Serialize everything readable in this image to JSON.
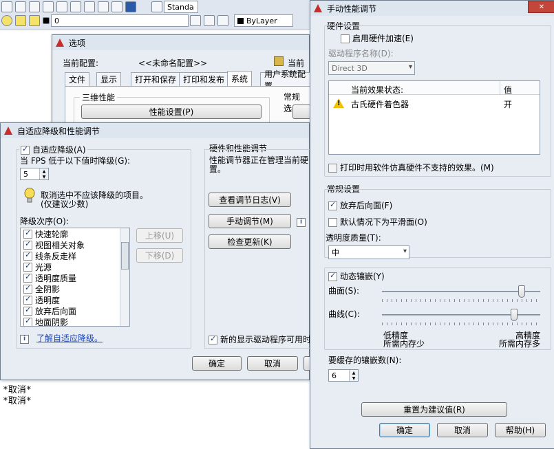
{
  "toolbar": {
    "layer_value": "0",
    "linetype_value": "ByLayer",
    "style_value": "Standa"
  },
  "command_line": [
    "*取消*",
    "*取消*"
  ],
  "options_dialog": {
    "title": "选项",
    "current_profile_label": "当前配置:",
    "current_profile_value": "<<未命名配置>>",
    "current_drawing_label": "当前图",
    "tabs": [
      "文件",
      "显示",
      "打开和保存",
      "打印和发布",
      "系统",
      "用户系统配置"
    ],
    "active_tab": "系统",
    "group_3d": "三维性能",
    "perf_settings_btn": "性能设置(P)",
    "group_general": "常规选"
  },
  "adaptive_dialog": {
    "title": "自适应降级和性能调节",
    "adaptive_degrade_label": "自适应降级(A)",
    "fps_label": "当 FPS 低于以下值时降级(G):",
    "fps_value": "5",
    "tip_line1": "取消选中不应该降级的项目。",
    "tip_line2": "(仅建议少数)",
    "degrade_order_label": "降级次序(O):",
    "items": [
      "快速轮廓",
      "视图相关对象",
      "线条反走样",
      "光源",
      "透明度质量",
      "全阴影",
      "透明度",
      "放弃后向面",
      "地面阴影"
    ],
    "move_up": "上移(U)",
    "move_down": "下移(D)",
    "learn_link": "了解自适应降级。",
    "hw_group": "硬件和性能调节",
    "hw_text_line1": "性能调节器正在管理当前硬",
    "hw_text_line2": "置。",
    "view_log_btn": "查看调节日志(V)",
    "manual_tune_btn": "手动调节(M)",
    "check_updates_btn": "检查更新(K)",
    "new_driver_label": "新的显示驱动程序可用时",
    "ok": "确定",
    "cancel": "取消"
  },
  "manual_dialog": {
    "title": "手动性能调节",
    "hw_group": "硬件设置",
    "enable_hw_accel": "启用硬件加速(E)",
    "driver_label": "驱动程序名称(D):",
    "driver_value": "Direct 3D",
    "effect_col": "当前效果状态:",
    "value_col": "值",
    "effect_row_name": "古氏硬件着色器",
    "effect_row_value": "开",
    "emulate_label": "打印时用软件仿真硬件不支持的效果。(M)",
    "general_group": "常规设置",
    "discard_back_faces": "放弃后向面(F)",
    "smooth_default": "默认情况下为平滑面(O)",
    "transparency_label": "透明度质量(T):",
    "transparency_value": "中",
    "dynamic_tess": "动态镶嵌(Y)",
    "surface_label": "曲面(S):",
    "curve_label": "曲线(C):",
    "surface_level": 0.9,
    "curve_level": 0.85,
    "low_precision": "低精度",
    "less_memory": "所需内存少",
    "high_precision": "高精度",
    "more_memory": "所需内存多",
    "cached_label": "要缓存的镶嵌数(N):",
    "cached_value": "6",
    "reset_btn": "重置为建议值(R)",
    "ok": "确定",
    "cancel": "取消",
    "help": "帮助(H)"
  }
}
